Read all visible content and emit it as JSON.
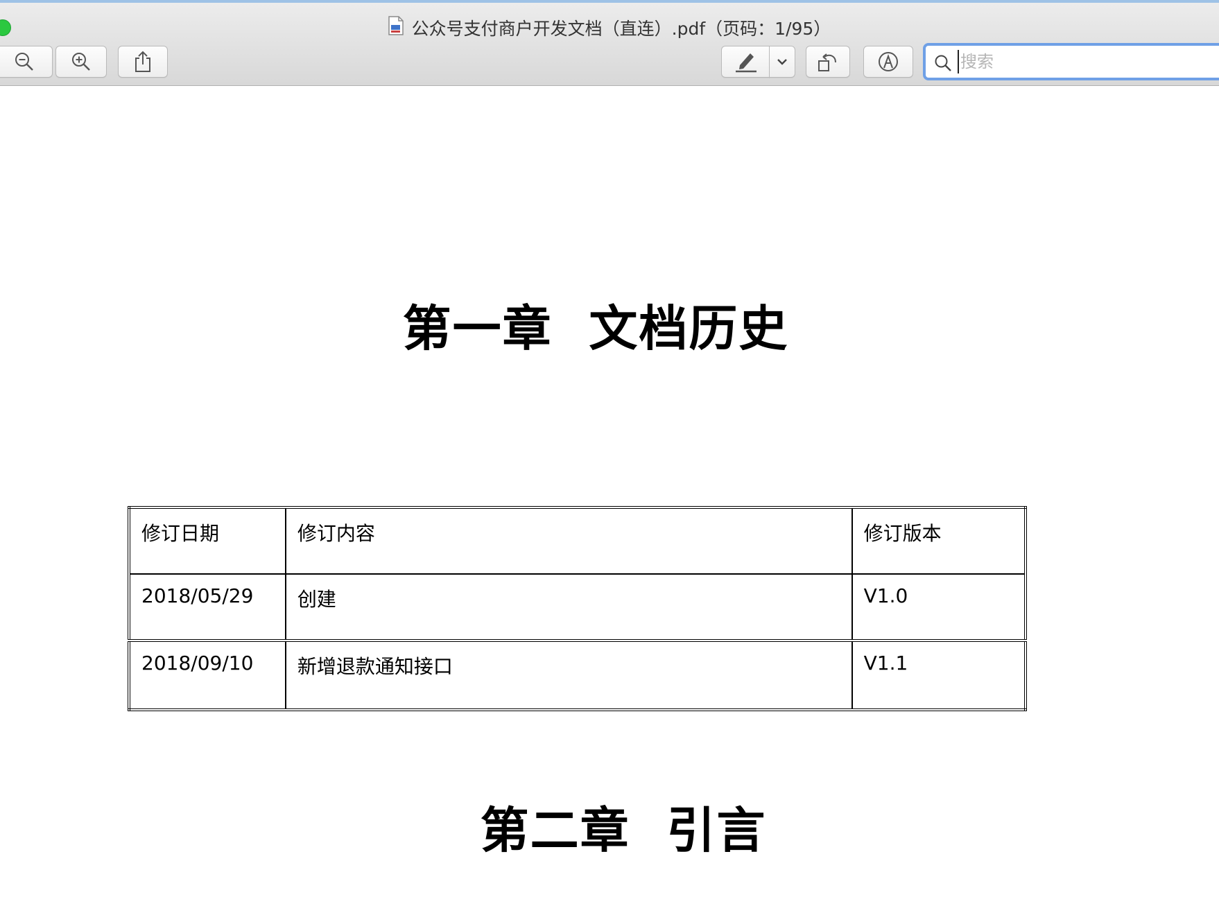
{
  "window": {
    "title": "公众号支付商户开发文档（直连）.pdf（页码：1/95）",
    "document_icon": "pdf-document-icon"
  },
  "toolbar": {
    "zoom_out_icon": "zoom-out-icon",
    "zoom_in_icon": "zoom-in-icon",
    "share_icon": "share-icon",
    "highlight_icon": "highlighter-pen-icon",
    "dropdown_icon": "chevron-down-icon",
    "rotate_icon": "rotate-left-icon",
    "markup_icon": "markup-pen-circle-icon",
    "search": {
      "placeholder": "搜索",
      "value": "",
      "icon": "search-icon"
    }
  },
  "document": {
    "chapter1_title": "第一章  文档历史",
    "chapter2_title": "第二章  引言",
    "revision_table": {
      "headers": [
        "修订日期",
        "修订内容",
        "修订版本"
      ],
      "rows": [
        [
          "2018/05/29",
          "创建",
          "V1.0"
        ],
        [
          "2018/09/10",
          "新增退款通知接口",
          "V1.1"
        ]
      ]
    }
  },
  "colors": {
    "search_focus_ring": "#6fa0e6",
    "traffic_green": "#2bc840",
    "toolbar_bg": "#dcdcdc"
  }
}
